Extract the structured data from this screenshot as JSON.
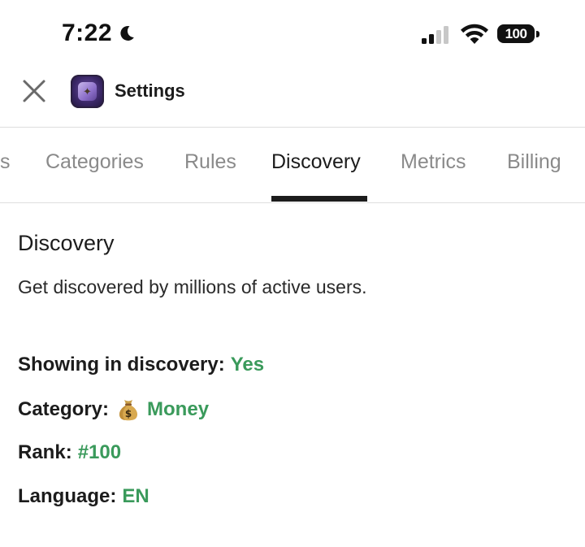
{
  "status_bar": {
    "time": "7:22",
    "battery_level": "100"
  },
  "header": {
    "title": "Settings",
    "close_icon": "close-icon",
    "app_icon": "app-icon"
  },
  "tabs": [
    {
      "label": "s",
      "active": false
    },
    {
      "label": "Categories",
      "active": false
    },
    {
      "label": "Rules",
      "active": false
    },
    {
      "label": "Discovery",
      "active": true
    },
    {
      "label": "Metrics",
      "active": false
    },
    {
      "label": "Billing",
      "active": false
    }
  ],
  "content": {
    "title": "Discovery",
    "description": "Get discovered by millions of active users.",
    "rows": [
      {
        "label": "Showing in discovery:",
        "value": "Yes"
      },
      {
        "label": "Category:",
        "value": "Money",
        "icon": "moneybag-icon"
      },
      {
        "label": "Rank:",
        "value": "#100"
      },
      {
        "label": "Language:",
        "value": "EN"
      }
    ]
  },
  "colors": {
    "accent_green": "#3a9a5b",
    "text_primary": "#1c1c1c",
    "tab_inactive": "#8a8a8a",
    "divider": "#dedede"
  }
}
